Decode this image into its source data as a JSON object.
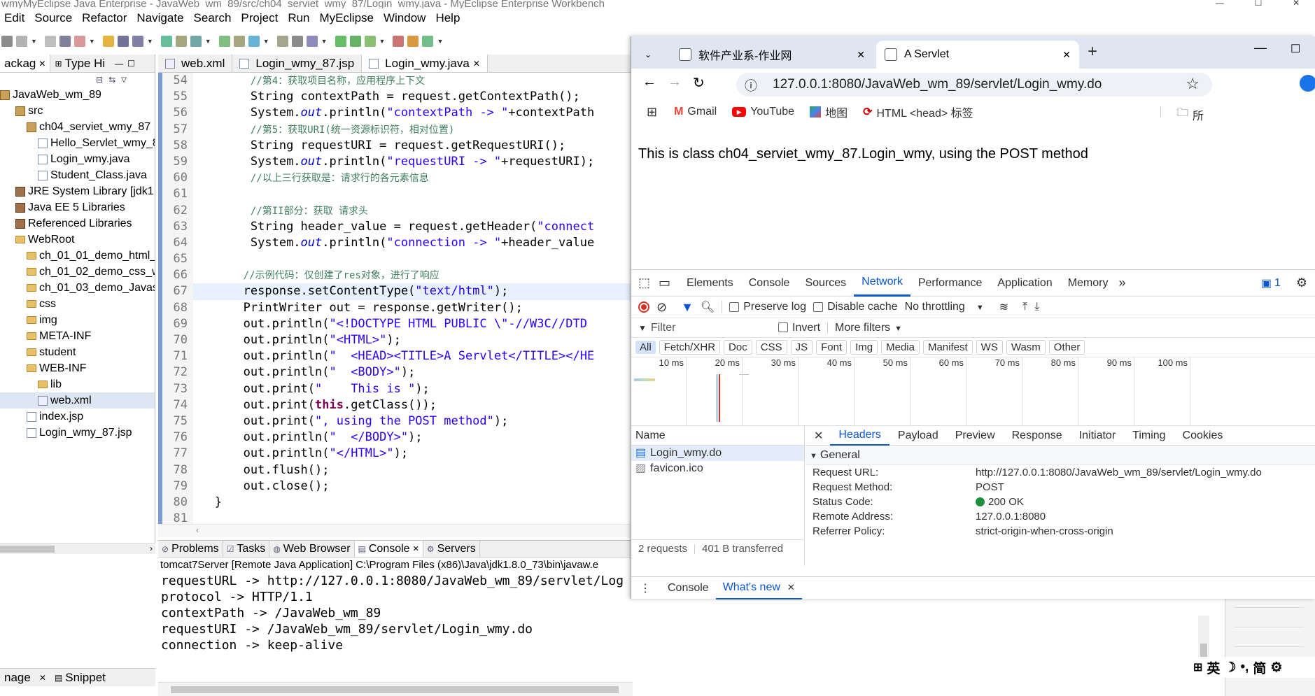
{
  "window": {
    "title": "wmyMyEclipse Java Enterprise - JavaWeb_wm_89/src/ch04_serviet_wmy_87/Login_wmy.java - MyEclipse Enterprise Workbench"
  },
  "menu": [
    "Edit",
    "Source",
    "Refactor",
    "Navigate",
    "Search",
    "Project",
    "Run",
    "MyEclipse",
    "Window",
    "Help"
  ],
  "left_panel": {
    "tabs": [
      "ackag",
      "Type Hi"
    ],
    "tree": [
      {
        "label": "JavaWeb_wm_89",
        "indent": 0,
        "icon": "project"
      },
      {
        "label": "src",
        "indent": 1,
        "icon": "pkg"
      },
      {
        "label": "ch04_serviet_wmy_87",
        "indent": 2,
        "icon": "pkg"
      },
      {
        "label": "Hello_Servlet_wmy_8",
        "indent": 3,
        "icon": "jfile"
      },
      {
        "label": "Login_wmy.java",
        "indent": 3,
        "icon": "jfile"
      },
      {
        "label": "Student_Class.java",
        "indent": 3,
        "icon": "jfile"
      },
      {
        "label": "JRE System Library [jdk1.8.",
        "indent": 1,
        "icon": "lib"
      },
      {
        "label": "Java EE 5 Libraries",
        "indent": 1,
        "icon": "lib"
      },
      {
        "label": "Referenced Libraries",
        "indent": 1,
        "icon": "lib"
      },
      {
        "label": "WebRoot",
        "indent": 1,
        "icon": "folder"
      },
      {
        "label": "ch_01_01_demo_html_w",
        "indent": 2,
        "icon": "folder"
      },
      {
        "label": "ch_01_02_demo_css_wn",
        "indent": 2,
        "icon": "folder"
      },
      {
        "label": "ch_01_03_demo_Javascı",
        "indent": 2,
        "icon": "folder"
      },
      {
        "label": "css",
        "indent": 2,
        "icon": "folder"
      },
      {
        "label": "img",
        "indent": 2,
        "icon": "folder"
      },
      {
        "label": "META-INF",
        "indent": 2,
        "icon": "folder"
      },
      {
        "label": "student",
        "indent": 2,
        "icon": "folder"
      },
      {
        "label": "WEB-INF",
        "indent": 2,
        "icon": "folder"
      },
      {
        "label": "lib",
        "indent": 3,
        "icon": "folder"
      },
      {
        "label": "web.xml",
        "indent": 3,
        "icon": "xml"
      },
      {
        "label": "index.jsp",
        "indent": 2,
        "icon": "jfile"
      },
      {
        "label": "Login_wmy_87.jsp",
        "indent": 2,
        "icon": "jfile"
      }
    ],
    "bottom_tabs": [
      "nage",
      "Snippet"
    ]
  },
  "editor": {
    "tabs": [
      "web.xml",
      "Login_wmy_87.jsp",
      "Login_wmy.java"
    ],
    "line_numbers": [
      "54",
      "55",
      "56",
      "57",
      "58",
      "59",
      "60",
      "61",
      "62",
      "63",
      "64",
      "65",
      "66",
      "67",
      "68",
      "69",
      "70",
      "71",
      "72",
      "73",
      "74",
      "75",
      "76",
      "77",
      "78",
      "79",
      "80",
      "81"
    ],
    "lines": [
      {
        "indent": "        ",
        "parts": [
          {
            "t": "//第4：获取项目名称，应用程序上下文",
            "c": "cm"
          }
        ]
      },
      {
        "indent": "        ",
        "parts": [
          {
            "t": "String contextPath = request.getContextPath();",
            "c": ""
          }
        ]
      },
      {
        "indent": "        ",
        "parts": [
          {
            "t": "System.",
            "c": ""
          },
          {
            "t": "out",
            "c": "it"
          },
          {
            "t": ".println(",
            "c": ""
          },
          {
            "t": "\"contextPath -> \"",
            "c": "st"
          },
          {
            "t": "+contextPath",
            "c": ""
          }
        ]
      },
      {
        "indent": "        ",
        "parts": [
          {
            "t": "//第5：获取URI(统一资源标识符，相对位置)",
            "c": "cm"
          }
        ]
      },
      {
        "indent": "        ",
        "parts": [
          {
            "t": "String requestURI = request.getRequestURI();",
            "c": ""
          }
        ]
      },
      {
        "indent": "        ",
        "parts": [
          {
            "t": "System.",
            "c": ""
          },
          {
            "t": "out",
            "c": "it"
          },
          {
            "t": ".println(",
            "c": ""
          },
          {
            "t": "\"requestURI -> \"",
            "c": "st"
          },
          {
            "t": "+requestURI);",
            "c": ""
          }
        ]
      },
      {
        "indent": "        ",
        "parts": [
          {
            "t": "//以上三行获取是：请求行的各元素信息",
            "c": "cm"
          }
        ]
      },
      {
        "indent": "",
        "parts": []
      },
      {
        "indent": "        ",
        "parts": [
          {
            "t": "//第II部分：获取 请求头",
            "c": "cm"
          }
        ]
      },
      {
        "indent": "        ",
        "parts": [
          {
            "t": "String header_value = request.getHeader(",
            "c": ""
          },
          {
            "t": "\"connect",
            "c": "st"
          }
        ]
      },
      {
        "indent": "        ",
        "parts": [
          {
            "t": "System.",
            "c": ""
          },
          {
            "t": "out",
            "c": "it"
          },
          {
            "t": ".println(",
            "c": ""
          },
          {
            "t": "\"connection -> \"",
            "c": "st"
          },
          {
            "t": "+header_value",
            "c": ""
          }
        ]
      },
      {
        "indent": "",
        "parts": []
      },
      {
        "indent": "       ",
        "parts": [
          {
            "t": "//示例代码：仅创建了res对象，进行了响应",
            "c": "cm"
          }
        ]
      },
      {
        "indent": "       ",
        "parts": [
          {
            "t": "response.setContentType(",
            "c": ""
          },
          {
            "t": "\"text/html\"",
            "c": "st"
          },
          {
            "t": ");",
            "c": ""
          }
        ],
        "hl": true
      },
      {
        "indent": "       ",
        "parts": [
          {
            "t": "PrintWriter out = response.getWriter();",
            "c": ""
          }
        ]
      },
      {
        "indent": "       ",
        "parts": [
          {
            "t": "out.println(",
            "c": ""
          },
          {
            "t": "\"<!DOCTYPE HTML PUBLIC \\\"-//W3C//DTD",
            "c": "st"
          }
        ]
      },
      {
        "indent": "       ",
        "parts": [
          {
            "t": "out.println(",
            "c": ""
          },
          {
            "t": "\"<HTML>\"",
            "c": "st"
          },
          {
            "t": ");",
            "c": ""
          }
        ]
      },
      {
        "indent": "       ",
        "parts": [
          {
            "t": "out.println(",
            "c": ""
          },
          {
            "t": "\"  <HEAD><TITLE>A Servlet</TITLE></HE",
            "c": "st"
          }
        ]
      },
      {
        "indent": "       ",
        "parts": [
          {
            "t": "out.println(",
            "c": ""
          },
          {
            "t": "\"  <BODY>\"",
            "c": "st"
          },
          {
            "t": ");",
            "c": ""
          }
        ]
      },
      {
        "indent": "       ",
        "parts": [
          {
            "t": "out.print(",
            "c": ""
          },
          {
            "t": "\"    This is \"",
            "c": "st"
          },
          {
            "t": ");",
            "c": ""
          }
        ]
      },
      {
        "indent": "       ",
        "parts": [
          {
            "t": "out.print(",
            "c": ""
          },
          {
            "t": "this",
            "c": "kw"
          },
          {
            "t": ".getClass());",
            "c": ""
          }
        ]
      },
      {
        "indent": "       ",
        "parts": [
          {
            "t": "out.print(",
            "c": ""
          },
          {
            "t": "\", using the POST method\"",
            "c": "st"
          },
          {
            "t": ");",
            "c": ""
          }
        ]
      },
      {
        "indent": "       ",
        "parts": [
          {
            "t": "out.println(",
            "c": ""
          },
          {
            "t": "\"  </BODY>\"",
            "c": "st"
          },
          {
            "t": ");",
            "c": ""
          }
        ]
      },
      {
        "indent": "       ",
        "parts": [
          {
            "t": "out.println(",
            "c": ""
          },
          {
            "t": "\"</HTML>\"",
            "c": "st"
          },
          {
            "t": ");",
            "c": ""
          }
        ]
      },
      {
        "indent": "       ",
        "parts": [
          {
            "t": "out.flush();",
            "c": ""
          }
        ]
      },
      {
        "indent": "       ",
        "parts": [
          {
            "t": "out.close();",
            "c": ""
          }
        ]
      },
      {
        "indent": "   ",
        "parts": [
          {
            "t": "}",
            "c": ""
          }
        ]
      },
      {
        "indent": "",
        "parts": []
      }
    ]
  },
  "bottom": {
    "tabs": [
      "Problems",
      "Tasks",
      "Web Browser",
      "Console",
      "Servers"
    ],
    "console_header": "tomcat7Server [Remote Java Application] C:\\Program Files (x86)\\Java\\jdk1.8.0_73\\bin\\javaw.e",
    "console_lines": [
      "requestURL -> http://127.0.0.1:8080/JavaWeb_wm_89/servlet/Log",
      "protocol -> HTTP/1.1",
      "contextPath -> /JavaWeb_wm_89",
      "requestURI -> /JavaWeb_wm_89/servlet/Login_wmy.do",
      "connection -> keep-alive"
    ]
  },
  "browser": {
    "tabs": [
      {
        "title": "软件产业系-作业网",
        "active": false
      },
      {
        "title": "A Servlet",
        "active": true
      }
    ],
    "url": "127.0.0.1:8080/JavaWeb_wm_89/servlet/Login_wmy.do",
    "bookmarks": [
      "Gmail",
      "YouTube",
      "地图",
      "HTML <head> 标签",
      "所"
    ],
    "page_text": "This is class ch04_serviet_wmy_87.Login_wmy, using the POST method",
    "devtools": {
      "tabs": [
        "Elements",
        "Console",
        "Sources",
        "Network",
        "Performance",
        "Application",
        "Memory"
      ],
      "active_tab": "Network",
      "issues_count": "1",
      "controls": {
        "preserve_log": "Preserve log",
        "disable_cache": "Disable cache",
        "throttling": "No throttling"
      },
      "filter_placeholder": "Filter",
      "invert": "Invert",
      "more_filters": "More filters",
      "type_filters": [
        "All",
        "Fetch/XHR",
        "Doc",
        "CSS",
        "JS",
        "Font",
        "Img",
        "Media",
        "Manifest",
        "WS",
        "Wasm",
        "Other"
      ],
      "timeline_ticks": [
        "10 ms",
        "20 ms",
        "30 ms",
        "40 ms",
        "50 ms",
        "60 ms",
        "70 ms",
        "80 ms",
        "90 ms",
        "100 ms"
      ],
      "name_header": "Name",
      "requests": [
        "Login_wmy.do",
        "favicon.ico"
      ],
      "status": {
        "requests": "2 requests",
        "transferred": "401 B transferred"
      },
      "detail_tabs": [
        "Headers",
        "Payload",
        "Preview",
        "Response",
        "Initiator",
        "Timing",
        "Cookies"
      ],
      "general_label": "General",
      "general": [
        {
          "k": "Request URL:",
          "v": "http://127.0.0.1:8080/JavaWeb_wm_89/servlet/Login_wmy.do"
        },
        {
          "k": "Request Method:",
          "v": "POST"
        },
        {
          "k": "Status Code:",
          "v": "200 OK"
        },
        {
          "k": "Remote Address:",
          "v": "127.0.0.1:8080"
        },
        {
          "k": "Referrer Policy:",
          "v": "strict-origin-when-cross-origin"
        }
      ],
      "drawer_tabs": [
        "Console",
        "What's new"
      ]
    }
  },
  "ime": [
    "英",
    "简"
  ],
  "colors": {
    "accent": "#0b57d0",
    "status_ok": "#1e8e3e",
    "record": "#d93025",
    "eclipse_blue": "#7b9ccf"
  }
}
